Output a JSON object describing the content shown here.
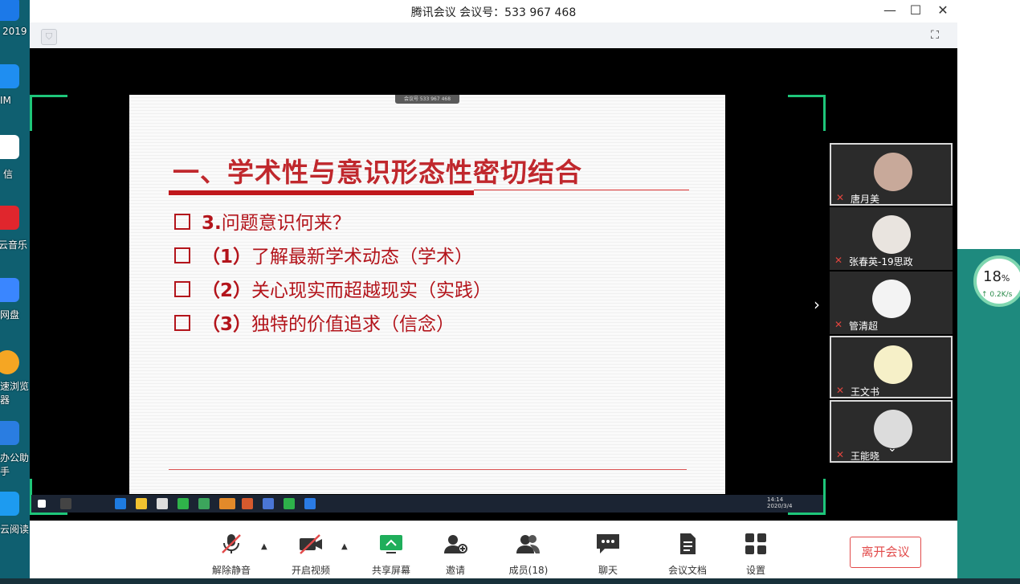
{
  "window": {
    "title": "腾讯会议 会议号：533 967 468",
    "minimize": "—",
    "maximize": "☐",
    "close": "✕"
  },
  "desktop": {
    "left_labels": [
      "2019",
      "IM",
      "信",
      "云音乐",
      "网盘",
      "速浏览",
      "器",
      "办公助",
      "手",
      "云阅读"
    ],
    "speed": {
      "percent": "18",
      "unit": "%",
      "rate": "↑ 0.2K/s"
    }
  },
  "slide": {
    "badge": "会议号 533 967 468",
    "title": "一、学术性与意识形态性密切结合",
    "bullets": [
      {
        "num": "3.",
        "text": "问题意识何来？"
      },
      {
        "num": "（1）",
        "text": "了解最新学术动态（学术）"
      },
      {
        "num": "（2）",
        "text": "关心现实而超越现实（实践）"
      },
      {
        "num": "（3）",
        "text": "独特的价值追求（信念）"
      }
    ],
    "taskbar_time": "14:14",
    "taskbar_date": "2020/3/4"
  },
  "participants": [
    {
      "name": "唐月美"
    },
    {
      "name": "张春英-19思政"
    },
    {
      "name": "管清超"
    },
    {
      "name": "王文书"
    },
    {
      "name": "王能晓"
    }
  ],
  "controls": {
    "mute": "解除静音",
    "video": "开启视频",
    "share": "共享屏幕",
    "invite": "邀请",
    "members": "成员(18)",
    "chat": "聊天",
    "docs": "会议文档",
    "settings": "设置",
    "leave": "离开会议"
  },
  "colors": {
    "accent_red": "#c0282d",
    "frame_green": "#1ec67a",
    "leave_red": "#e24a4a"
  }
}
